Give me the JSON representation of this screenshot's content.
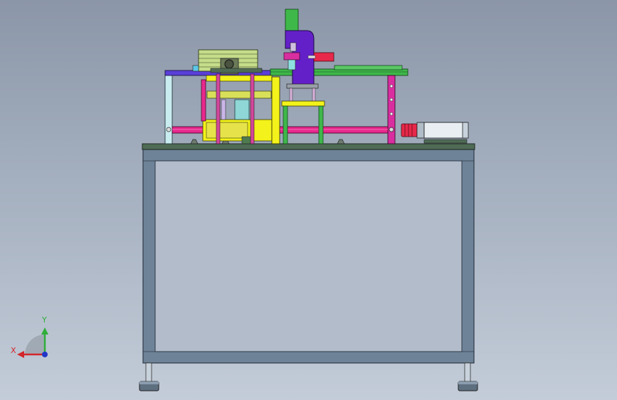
{
  "viewport": {
    "background_top": "#8b96a8",
    "background_bottom": "#c3ccd8"
  },
  "triad": {
    "x_label": "X",
    "y_label": "Y",
    "x_color": "#d2262b",
    "y_color": "#2fae3a",
    "z_color": "#2236c8"
  },
  "model": {
    "frame_color": "#6e8397",
    "top_plate_color": "#4f6b55",
    "pink_color": "#e8288d",
    "yellow_color": "#f3f21a",
    "green_color": "#3fb84a",
    "purple_color": "#6420c8",
    "motor_color": "#e8eef2",
    "icons": [
      "table-frame",
      "servo-motor",
      "press-unit",
      "rodless-cylinder",
      "gearbox",
      "leveling-foot"
    ]
  }
}
